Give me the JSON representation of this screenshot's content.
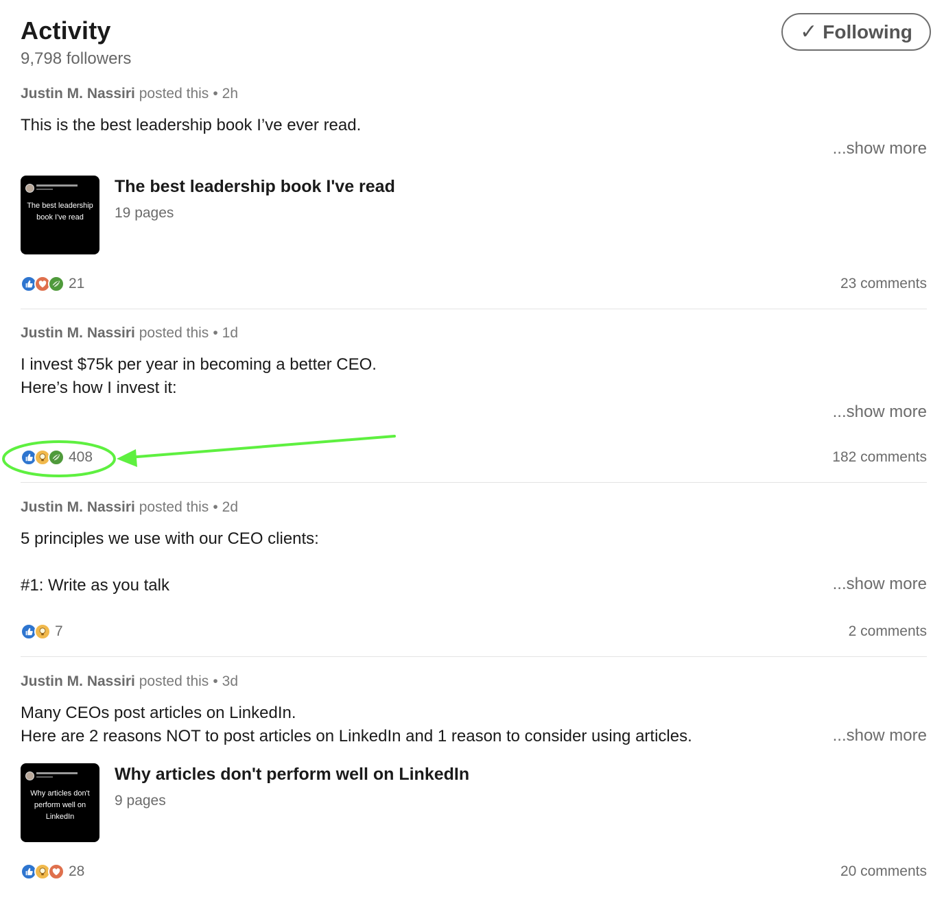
{
  "header": {
    "title": "Activity",
    "followers": "9,798 followers",
    "follow_button_label": "Following",
    "follow_button_icon": "check-icon"
  },
  "posts": [
    {
      "author": "Justin M. Nassiri",
      "action": "posted this",
      "time": "2h",
      "text_lines": [
        "This is the best leadership book I’ve ever read."
      ],
      "show_more": "...show more",
      "document": {
        "thumb_text": "The best leadership book I've read",
        "title": "The best leadership book I've read",
        "pages": "19 pages"
      },
      "reactions": [
        "like",
        "love",
        "support"
      ],
      "reaction_count": "21",
      "comments": "23 comments"
    },
    {
      "author": "Justin M. Nassiri",
      "action": "posted this",
      "time": "1d",
      "text_lines": [
        "I invest $75k per year in becoming a better CEO.",
        "Here’s how I invest it:"
      ],
      "show_more": "...show more",
      "reactions": [
        "like",
        "insightful",
        "support"
      ],
      "reaction_count": "408",
      "comments": "182 comments"
    },
    {
      "author": "Justin M. Nassiri",
      "action": "posted this",
      "time": "2d",
      "text_lines": [
        "5 principles we use with our CEO clients:",
        "",
        "#1: Write as you talk"
      ],
      "show_more": "...show more",
      "reactions": [
        "like",
        "insightful"
      ],
      "reaction_count": "7",
      "comments": "2 comments"
    },
    {
      "author": "Justin M. Nassiri",
      "action": "posted this",
      "time": "3d",
      "text_lines": [
        "Many CEOs post articles on LinkedIn.",
        "Here are 2 reasons NOT to post articles on LinkedIn and 1 reason to consider using articles."
      ],
      "show_more": "...show more",
      "document": {
        "thumb_text": "Why articles don't perform well on LinkedIn",
        "title": "Why articles don't perform well on LinkedIn",
        "pages": "9 pages"
      },
      "reactions": [
        "like",
        "insightful",
        "love"
      ],
      "reaction_count": "28",
      "comments": "20 comments"
    }
  ],
  "colors": {
    "annotation": "#5ef040",
    "like": "#2e75cf",
    "love": "#df704d",
    "support": "#4f9a3b",
    "insightful": "#f1b94c"
  }
}
